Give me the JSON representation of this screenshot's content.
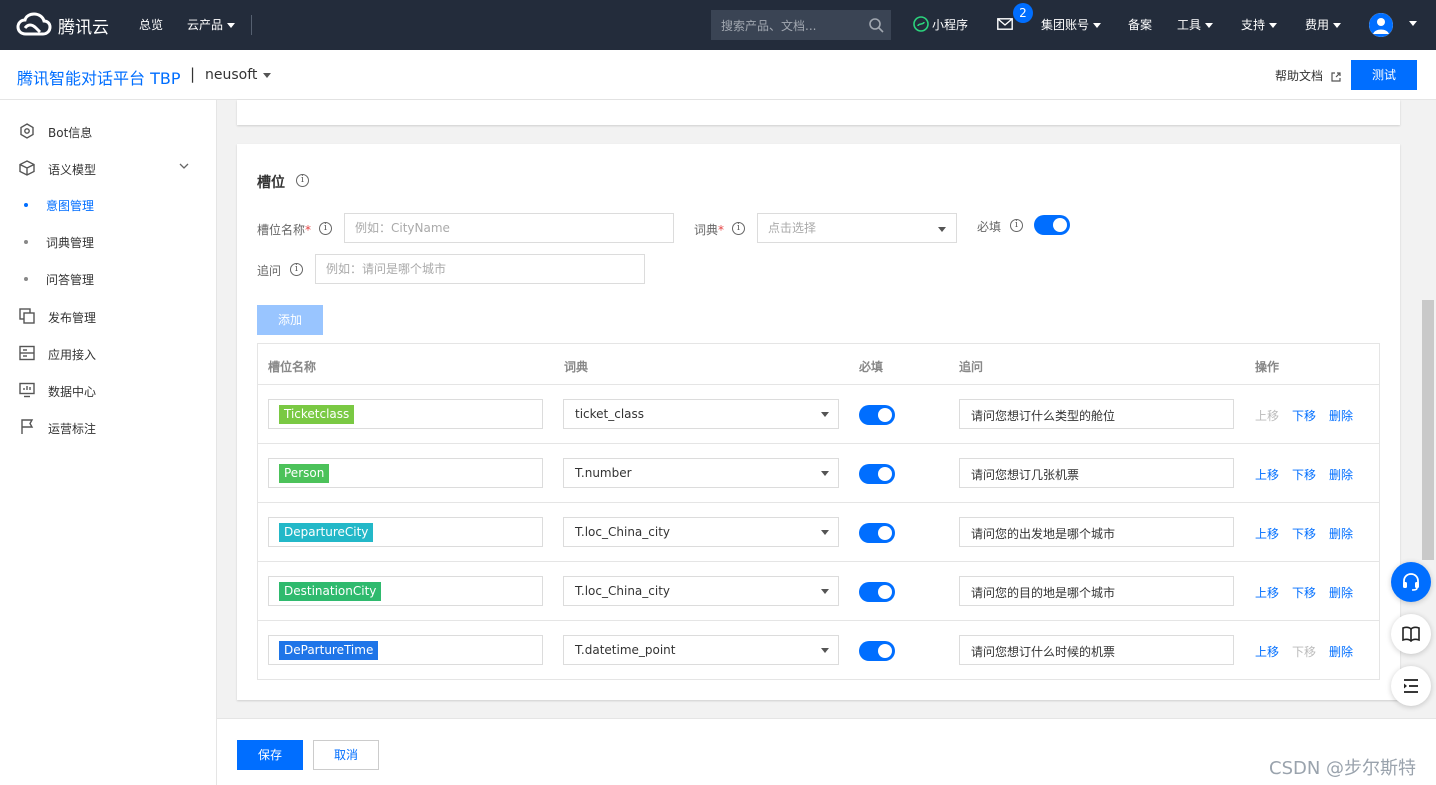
{
  "topbar": {
    "logo_text": "腾讯云",
    "nav": {
      "overview": "总览",
      "products": "云产品",
      "search_placeholder": "搜索产品、文档...",
      "mini_program": "小程序",
      "mail_badge": "2",
      "group_account": "集团账号",
      "icp": "备案",
      "tools": "工具",
      "support": "支持",
      "billing": "费用"
    }
  },
  "subheader": {
    "product_title": "腾讯智能对话平台 TBP",
    "separator": "|",
    "project": "neusoft",
    "help_docs": "帮助文档",
    "test_button": "测试"
  },
  "sidebar": {
    "items": [
      {
        "label": "Bot信息",
        "icon": "hexagon-icon"
      },
      {
        "label": "语义模型",
        "icon": "cube-icon"
      },
      {
        "label": "意图管理",
        "sub": true,
        "active": true
      },
      {
        "label": "词典管理",
        "sub": true
      },
      {
        "label": "问答管理",
        "sub": true
      },
      {
        "label": "发布管理",
        "icon": "layers-icon"
      },
      {
        "label": "应用接入",
        "icon": "app-icon"
      },
      {
        "label": "数据中心",
        "icon": "monitor-icon"
      },
      {
        "label": "运营标注",
        "icon": "flag-icon"
      }
    ]
  },
  "slots": {
    "title": "槽位",
    "form": {
      "name_label": "槽位名称",
      "name_required": "*",
      "name_placeholder": "例如：CityName",
      "dict_label": "词典",
      "dict_required": "*",
      "dict_placeholder": "点击选择",
      "required_label": "必填",
      "required_on": true,
      "followup_label": "追问",
      "followup_placeholder": "例如：请问是哪个城市"
    },
    "add_button": "添加",
    "table": {
      "headers": {
        "name": "槽位名称",
        "dict": "词典",
        "required": "必填",
        "followup": "追问",
        "actions": "操作"
      },
      "rows": [
        {
          "name": "Ticketclass",
          "tag_color": "#7ac943",
          "dict": "ticket_class",
          "required": true,
          "followup": "请问您想订什么类型的舱位",
          "up": "上移",
          "down": "下移",
          "delete": "删除",
          "up_disabled": true,
          "down_disabled": false
        },
        {
          "name": "Person",
          "tag_color": "#4cc25a",
          "dict": "T.number",
          "required": true,
          "followup": "请问您想订几张机票",
          "up": "上移",
          "down": "下移",
          "delete": "删除",
          "up_disabled": false,
          "down_disabled": false
        },
        {
          "name": "DepartureCity",
          "tag_color": "#23b8c8",
          "dict": "T.loc_China_city",
          "required": true,
          "followup": "请问您的出发地是哪个城市",
          "up": "上移",
          "down": "下移",
          "delete": "删除",
          "up_disabled": false,
          "down_disabled": false
        },
        {
          "name": "DestinationCity",
          "tag_color": "#2fba6e",
          "dict": "T.loc_China_city",
          "required": true,
          "followup": "请问您的目的地是哪个城市",
          "up": "上移",
          "down": "下移",
          "delete": "删除",
          "up_disabled": false,
          "down_disabled": false
        },
        {
          "name": "DePartureTime",
          "tag_color": "#1f75e8",
          "dict": "T.datetime_point",
          "required": true,
          "followup": "请问您想订什么时候的机票",
          "up": "上移",
          "down": "下移",
          "delete": "删除",
          "up_disabled": false,
          "down_disabled": true
        }
      ]
    }
  },
  "footer": {
    "save": "保存",
    "cancel": "取消"
  },
  "watermark": "CSDN @步尔斯特",
  "colors": {
    "primary": "#006eff",
    "topbar_bg": "#232c3b",
    "disabled_text": "#bbbbbb"
  }
}
